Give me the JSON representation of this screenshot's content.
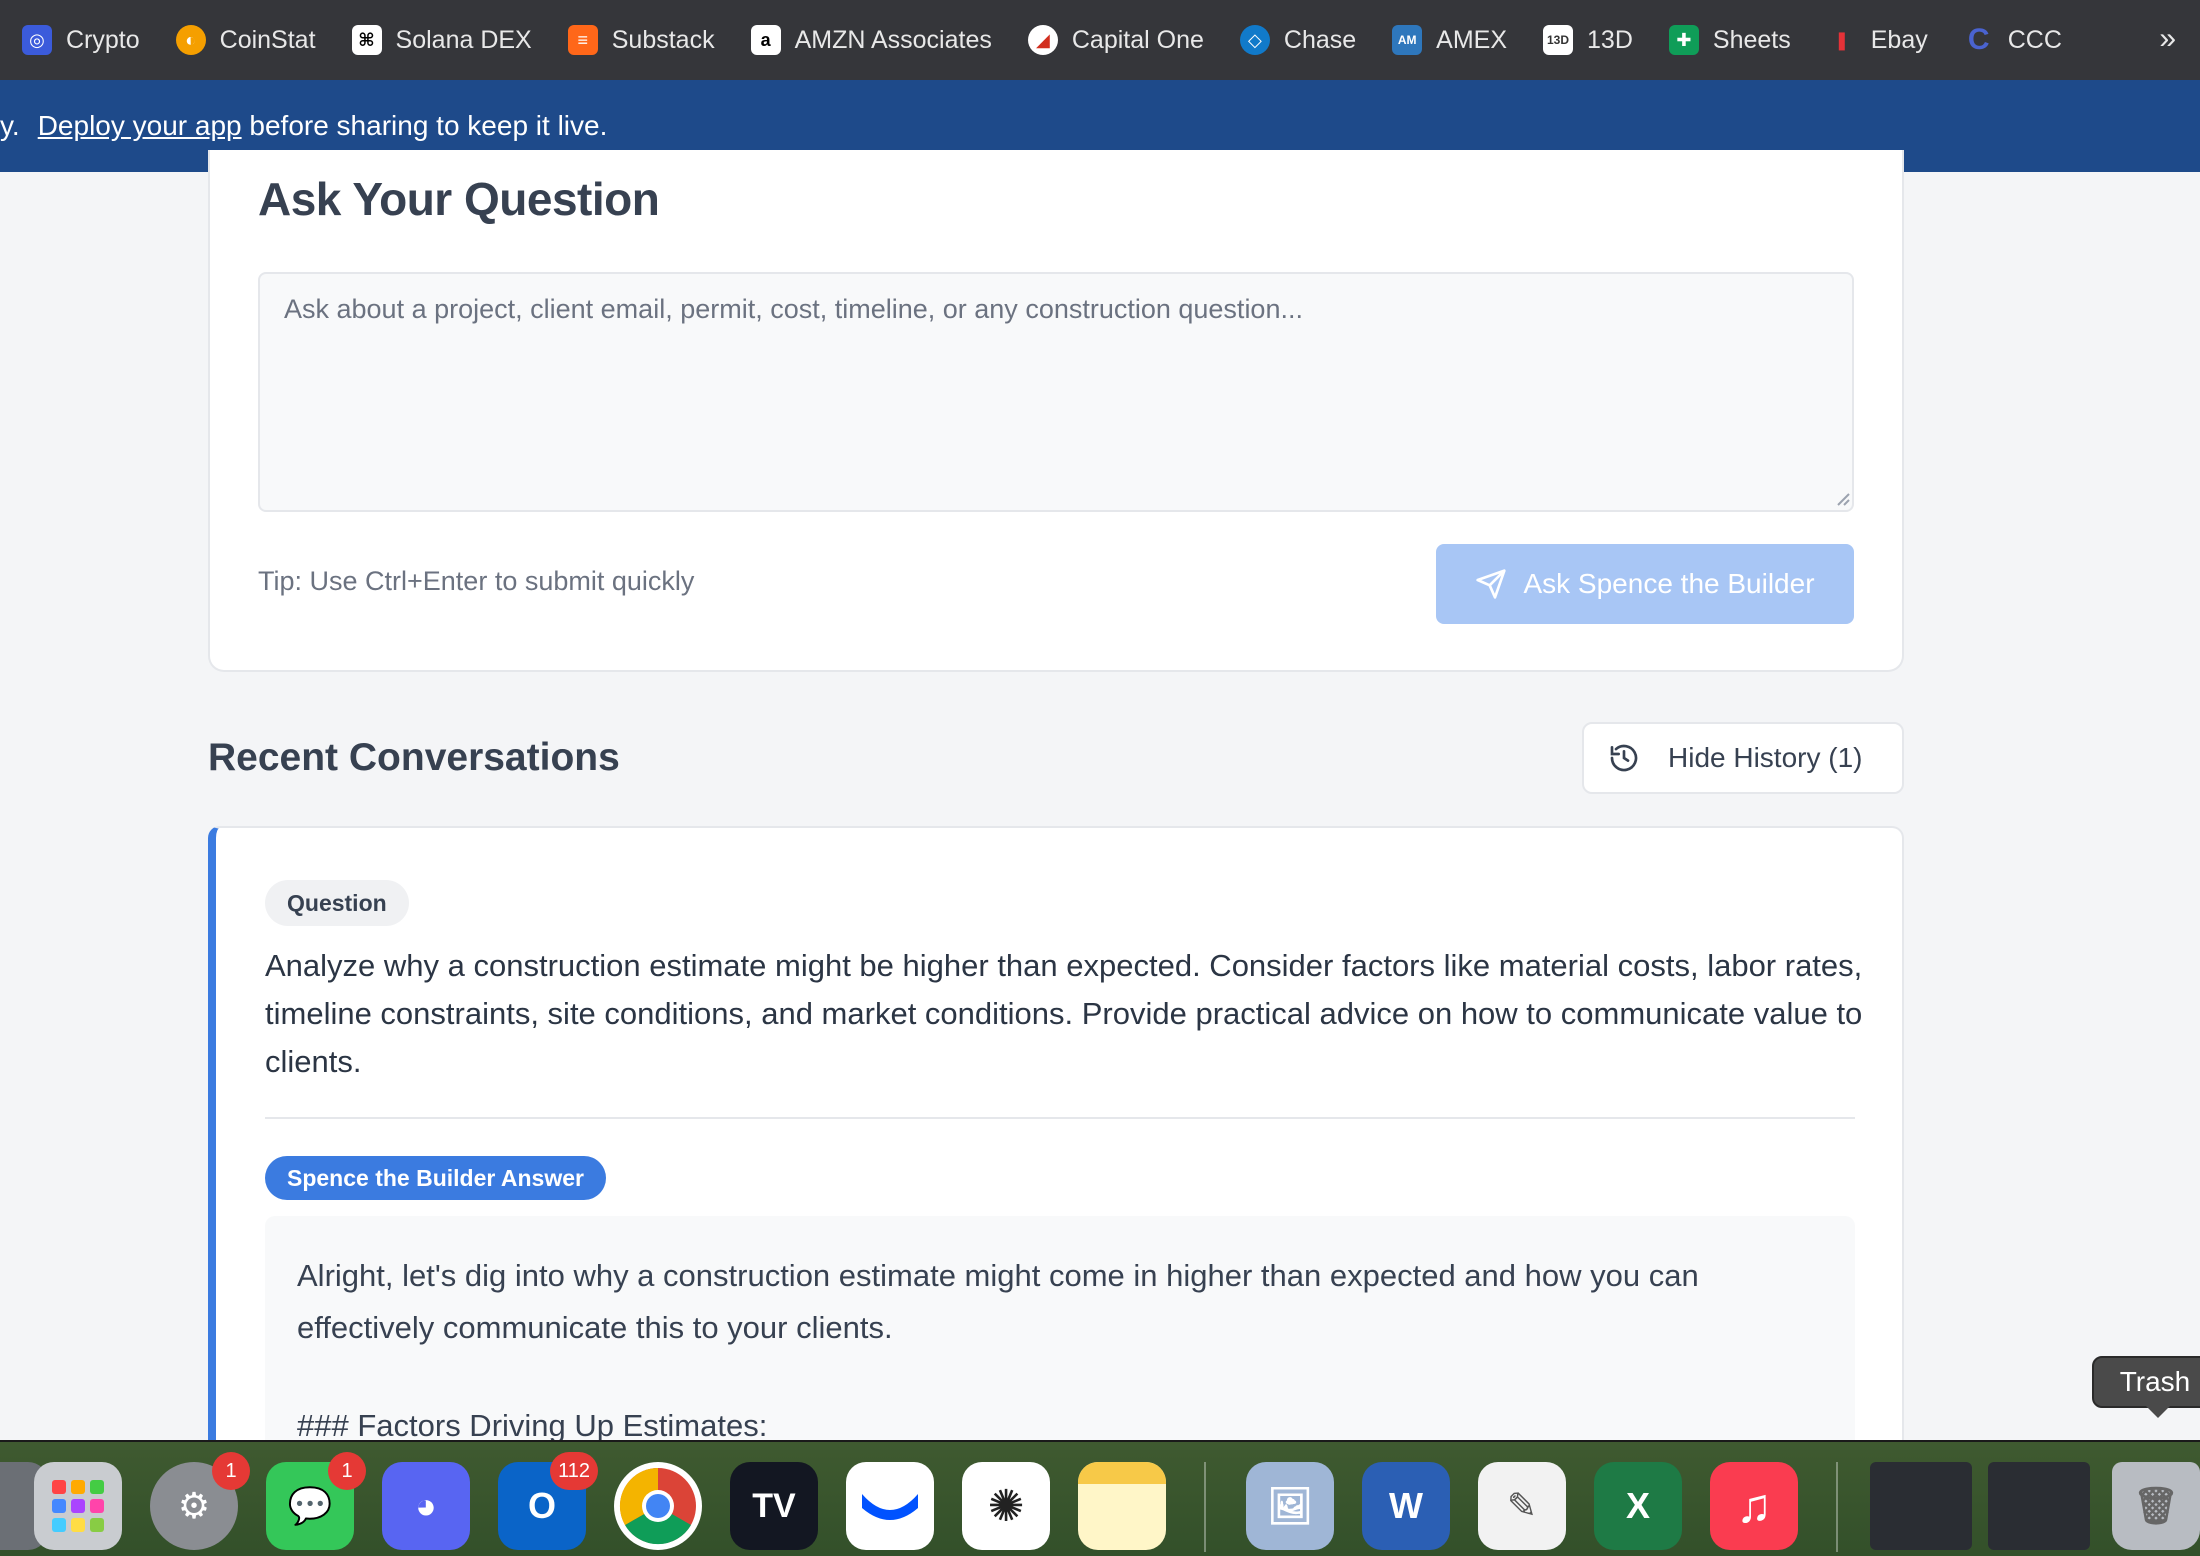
{
  "bookmarks": [
    {
      "label": "Crypto",
      "icon": "crypto-icon",
      "color": "#3b5bdb"
    },
    {
      "label": "CoinStat",
      "icon": "coinstat-icon",
      "color": "#f59f00"
    },
    {
      "label": "Solana DEX",
      "icon": "owl-icon",
      "color": "#ffffff"
    },
    {
      "label": "Substack",
      "icon": "substack-icon",
      "color": "#ff6719"
    },
    {
      "label": "AMZN Associates",
      "icon": "amazon-icon",
      "color": "#ffffff"
    },
    {
      "label": "Capital One",
      "icon": "capital-one-icon",
      "color": "#d22e1e"
    },
    {
      "label": "Chase",
      "icon": "chase-icon",
      "color": "#117aca"
    },
    {
      "label": "AMEX",
      "icon": "amex-icon",
      "color": "#2e77bc"
    },
    {
      "label": "13D",
      "icon": "13d-icon",
      "color": "#ffffff"
    },
    {
      "label": "Sheets",
      "icon": "sheets-icon",
      "color": "#0f9d58"
    },
    {
      "label": "Ebay",
      "icon": "ebay-icon",
      "color": "#e53238"
    },
    {
      "label": "CCC",
      "icon": "ccc-icon",
      "color": "#2b3a8c"
    }
  ],
  "bookmarks_more": "»",
  "banner": {
    "lead": "y.",
    "link": "Deploy your app",
    "rest": " before sharing to keep it live."
  },
  "ask": {
    "title": "Ask Your Question",
    "placeholder": "Ask about a project, client email, permit, cost, timeline, or any construction question...",
    "tip": "Tip: Use Ctrl+Enter to submit quickly",
    "button": "Ask Spence the Builder"
  },
  "recent": {
    "title": "Recent Conversations",
    "history_button": "Hide History (1)"
  },
  "conversation": {
    "question_tag": "Question",
    "question": "Analyze why a construction estimate might be higher than expected. Consider factors like material costs, labor rates, timeline constraints, site conditions, and market conditions. Provide practical advice on how to communicate value to clients.",
    "answer_tag": "Spence the Builder Answer",
    "answer_intro": "Alright, let's dig into why a construction estimate might come in higher than expected and how you can effectively communicate this to your clients.",
    "answer_heading": "### Factors Driving Up Estimates:"
  },
  "tooltip": "Trash",
  "dock": [
    {
      "name": "launchpad",
      "color": "#c0c4c8",
      "label": ""
    },
    {
      "name": "system-settings",
      "color": "#8a8d92",
      "label": "",
      "badge": "1"
    },
    {
      "name": "messages",
      "color": "#34c759",
      "label": "",
      "badge": "1"
    },
    {
      "name": "discord",
      "color": "#5865f2",
      "label": ""
    },
    {
      "name": "outlook",
      "color": "#0a64c8",
      "label": "O",
      "badge": "112"
    },
    {
      "name": "chrome",
      "color": "#ffffff",
      "label": ""
    },
    {
      "name": "tradingview",
      "color": "#131722",
      "label": "TV"
    },
    {
      "name": "coinbase-wallet",
      "color": "#ffffff",
      "label": ""
    },
    {
      "name": "chatgpt",
      "color": "#ffffff",
      "label": ""
    },
    {
      "name": "notes",
      "color": "#fff6c8",
      "label": ""
    },
    {
      "name": "preview",
      "color": "#9fb6d6",
      "label": ""
    },
    {
      "name": "word",
      "color": "#2b5fb4",
      "label": "W"
    },
    {
      "name": "textedit",
      "color": "#f2f2f2",
      "label": ""
    },
    {
      "name": "excel",
      "color": "#1e7a45",
      "label": "X"
    },
    {
      "name": "music",
      "color": "#fa3c50",
      "label": "♫"
    },
    {
      "name": "window-1",
      "color": "#2a2d33",
      "label": ""
    },
    {
      "name": "window-2",
      "color": "#2a2d33",
      "label": ""
    },
    {
      "name": "trash",
      "color": "#b8bcc2",
      "label": ""
    }
  ],
  "colors": {
    "accent": "#3b7be0",
    "button_disabled": "#a8c6f5",
    "banner": "#1e4a8a"
  }
}
